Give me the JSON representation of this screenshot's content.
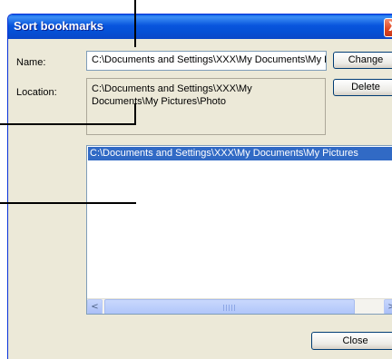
{
  "window": {
    "title": "Sort bookmarks"
  },
  "titlebar": {
    "close_icon": "close-icon",
    "close_glyph": "X"
  },
  "name_row": {
    "label": "Name:",
    "value": "C:\\Documents and Settings\\XXX\\My Documents\\My Pictures\\Photo",
    "change_label": "Change"
  },
  "location_row": {
    "label": "Location:",
    "value": "C:\\Documents and Settings\\XXX\\My Documents\\My Pictures\\Photo",
    "delete_label": "Delete"
  },
  "bookmark_list": {
    "items": [
      "C:\\Documents and Settings\\XXX\\My Documents\\My Pictures"
    ],
    "scroll_left_icon": "scroll-left-arrow-icon",
    "scroll_right_icon": "scroll-right-arrow-icon",
    "scroll_left_glyph": "<",
    "scroll_right_glyph": ">"
  },
  "footer": {
    "close_label": "Close"
  },
  "colors": {
    "titlebar": "#0855dd",
    "window_bg": "#ece9d8",
    "selection": "#316ac5"
  }
}
